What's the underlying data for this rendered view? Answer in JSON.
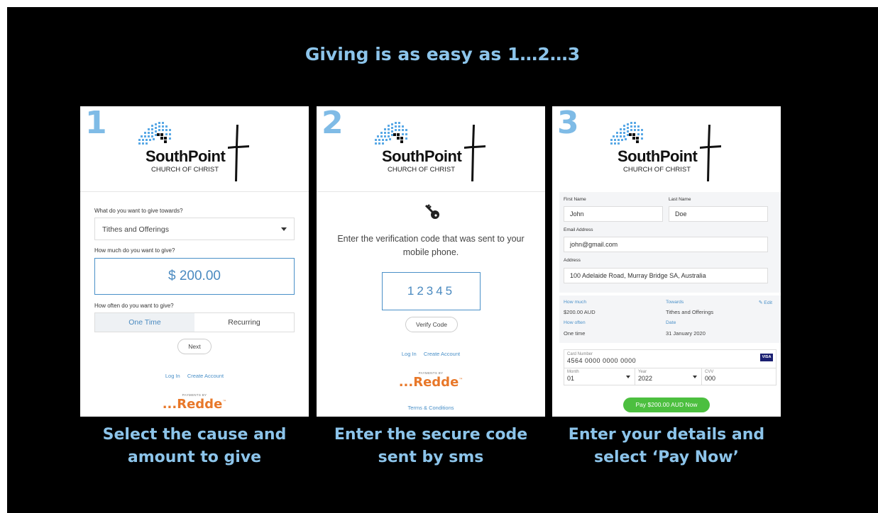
{
  "slide": {
    "title": "Giving is as easy as 1…2…3"
  },
  "logo": {
    "name": "SouthPoint",
    "subtitle": "CHURCH OF CHRIST"
  },
  "panel1": {
    "step": "1",
    "cause_label": "What do you want to give towards?",
    "cause_value": "Tithes and Offerings",
    "amount_label": "How much do you want to give?",
    "amount_value": "$ 200.00",
    "frequency_label": "How often do you want to give?",
    "one_time": "One Time",
    "recurring": "Recurring",
    "next": "Next",
    "login": "Log In",
    "create_account": "Create Account",
    "payments_by": "PAYMENTS BY",
    "redde": "...Redde",
    "redde_tm": "™"
  },
  "panel2": {
    "step": "2",
    "verify_text": "Enter the verification code that was sent to your mobile phone.",
    "code": "12345",
    "verify_button": "Verify Code",
    "login": "Log In",
    "create_account": "Create Account",
    "payments_by": "PAYMENTS BY",
    "redde": "...Redde",
    "redde_tm": "™",
    "terms": "Terms & Conditions"
  },
  "panel3": {
    "step": "3",
    "first_name_label": "First Name",
    "first_name": "John",
    "last_name_label": "Last Name",
    "last_name": "Doe",
    "email_label": "Email Address",
    "email": "john@gmail.com",
    "address_label": "Address",
    "address": "100 Adelaide Road, Murray Bridge SA, Australia",
    "how_much_label": "How much",
    "how_much": "$200.00 AUD",
    "towards_label": "Towards",
    "towards": "Tithes and Offerings",
    "how_often_label": "How often",
    "how_often": "One time",
    "date_label": "Date",
    "date": "31 January 2020",
    "edit": "✎ Edit",
    "card_number_label": "Card Number",
    "card_number": "4564 0000 0000 0000",
    "card_brand": "VISA",
    "month_label": "Month",
    "month": "01",
    "year_label": "Year",
    "year": "2022",
    "cvv_label": "CVV",
    "cvv": "000",
    "pay_button": "Pay $200.00 AUD Now"
  },
  "captions": {
    "c1": "Select the cause and amount to give",
    "c2": "Enter the secure code sent by sms",
    "c3": "Enter your details and select ‘Pay Now’"
  },
  "colors": {
    "background": "#000000",
    "title_blue": "#8cc4ea",
    "link_blue": "#4a90c8",
    "redde_orange": "#e8782a",
    "pay_green": "#4cbf3f"
  }
}
